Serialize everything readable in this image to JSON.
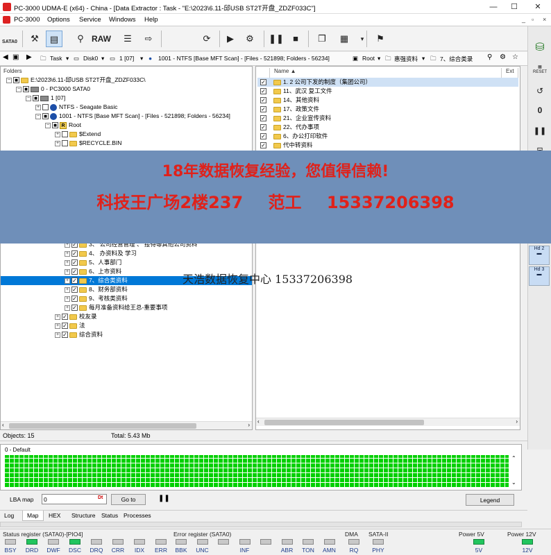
{
  "window": {
    "title": "PC-3000 UDMA-E (x64) - China - [Data Extractor : Task - \"E:\\2023\\6.11-邱USB ST2T开盘_ZDZF033C\"]",
    "controls": [
      "—",
      "☐",
      "✕"
    ]
  },
  "menu": {
    "items": [
      "PC-3000",
      "Options",
      "Service",
      "Windows",
      "Help"
    ],
    "mdi_controls": [
      "_",
      "▫",
      "×"
    ]
  },
  "toolbar": {
    "sata_label": "SATA0",
    "raw_label": "RAW"
  },
  "addressbar": {
    "task": "Task",
    "disk": "Disk0",
    "partition": "1 [07]",
    "volume": "1001 - NTFS [Base MFT Scan] - [Files - 521898; Folders - 56234]",
    "root": "Root",
    "folder1": "惠强资料",
    "folder2": "7、综合类录"
  },
  "tree": {
    "header": "Folders",
    "rows": [
      {
        "text": "E:\\2023\\6.11-邱USB ST2T开盘_ZDZF033C\\"
      },
      {
        "text": "0 - PC3000 SATA0"
      },
      {
        "text": "1 [07]"
      },
      {
        "text": "NTFS - Seagate Basic"
      },
      {
        "text": "1001 - NTFS [Base MFT Scan] - [Files - 521898; Folders - 56234]"
      },
      {
        "text": "Root"
      },
      {
        "text": "$Extend"
      },
      {
        "text": "$RECYCLE.BIN"
      },
      {
        "text": "3、 公司经营管理 、 接待等其他公司资料"
      },
      {
        "text": "4、 办资料及 学习"
      },
      {
        "text": "5、人事部门"
      },
      {
        "text": "6、上市资料"
      },
      {
        "text": "7、综合类资料"
      },
      {
        "text": "8、财务部资料"
      },
      {
        "text": "9、考核类资料"
      },
      {
        "text": "每月准备资料给王总-重要事项"
      },
      {
        "text": "校友录"
      },
      {
        "text": "法"
      },
      {
        "text": "综合资料"
      }
    ]
  },
  "filelist": {
    "col_name": "Name",
    "col_ext": "Ext",
    "rows": [
      {
        "name": "1. 2    公司下发的制度（集团公司）"
      },
      {
        "name": "11、武汉    复工文件"
      },
      {
        "name": "14、其他资料"
      },
      {
        "name": "17、政策文件"
      },
      {
        "name": "21、企业宣传资料"
      },
      {
        "name": "22、代办事项"
      },
      {
        "name": "6、办公打印软件"
      },
      {
        "name": "代中转资料"
      }
    ]
  },
  "banner": {
    "line1": "18年数据恢复经验，您值得信赖!",
    "line2": "科技王广场2楼237 范工 15337206398",
    "watermark": "天浩数据恢复中心 15337206398"
  },
  "status": {
    "objects": "Objects: 15",
    "total": "Total: 5.43 Mb"
  },
  "map": {
    "profile": "0 - Default",
    "lba_label": "LBA map",
    "lba_value": "0",
    "goto": "Go to",
    "legend": "Legend"
  },
  "tabs": [
    "Log",
    "Map",
    "HEX",
    "Structure",
    "Status",
    "Processes"
  ],
  "registers": {
    "status_title": "Status register (SATA0)-[PIO4]",
    "status_bits": [
      {
        "label": "BSY",
        "on": false
      },
      {
        "label": "DRD",
        "on": true
      },
      {
        "label": "DWF",
        "on": false
      },
      {
        "label": "DSC",
        "on": true
      },
      {
        "label": "DRQ",
        "on": false
      },
      {
        "label": "CRR",
        "on": false
      },
      {
        "label": "IDX",
        "on": false
      },
      {
        "label": "ERR",
        "on": false
      }
    ],
    "error_title": "Error register (SATA0)",
    "error_bits": [
      {
        "label": "BBK",
        "on": false
      },
      {
        "label": "UNC",
        "on": false
      },
      {
        "label": "",
        "on": false
      },
      {
        "label": "INF",
        "on": false
      },
      {
        "label": "",
        "on": false
      },
      {
        "label": "ABR",
        "on": false
      },
      {
        "label": "TON",
        "on": false
      },
      {
        "label": "AMN",
        "on": false
      }
    ],
    "dma_title": "DMA",
    "dma_label": "RQ",
    "sata_title": "SATA-II",
    "sata_label": "PHY",
    "power5_title": "Power 5V",
    "power5_label": "5V",
    "power12_title": "Power 12V",
    "power12_label": "12V"
  },
  "side": {
    "reset_label": "RESET",
    "hd2": "Hd 2",
    "hd3": "Hd 3"
  },
  "colors": {
    "banner_bg": "#6f8fb9",
    "banner_text": "#e0211a",
    "selection": "#0078d7",
    "map_good": "#00d000"
  }
}
